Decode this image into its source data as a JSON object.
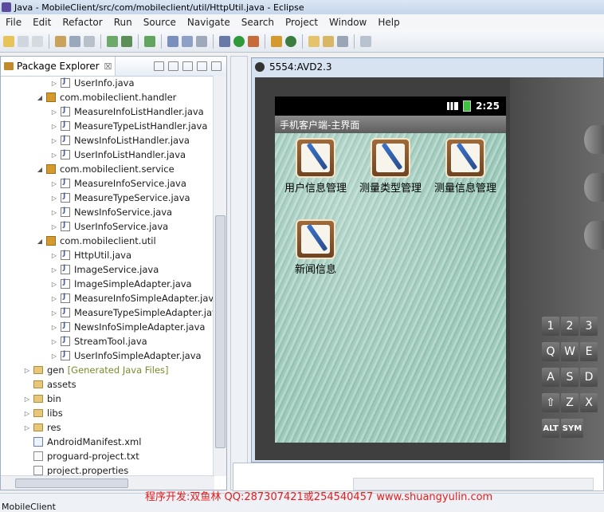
{
  "window": {
    "title": "Java - MobileClient/src/com/mobileclient/util/HttpUtil.java - Eclipse"
  },
  "menu": [
    "File",
    "Edit",
    "Refactor",
    "Run",
    "Source",
    "Navigate",
    "Search",
    "Project",
    "Window",
    "Help"
  ],
  "package_explorer": {
    "tab_label": "Package Explorer",
    "close_glyph": "☒",
    "rows": [
      {
        "label": "UserInfo.java",
        "extra": ""
      },
      {
        "label": "com.mobileclient.handler",
        "extra": ""
      },
      {
        "label": "MeasureInfoListHandler.java",
        "extra": ""
      },
      {
        "label": "MeasureTypeListHandler.java",
        "extra": ""
      },
      {
        "label": "NewsInfoListHandler.java",
        "extra": ""
      },
      {
        "label": "UserInfoListHandler.java",
        "extra": ""
      },
      {
        "label": "com.mobileclient.service",
        "extra": ""
      },
      {
        "label": "MeasureInfoService.java",
        "extra": ""
      },
      {
        "label": "MeasureTypeService.java",
        "extra": ""
      },
      {
        "label": "NewsInfoService.java",
        "extra": ""
      },
      {
        "label": "UserInfoService.java",
        "extra": ""
      },
      {
        "label": "com.mobileclient.util",
        "extra": ""
      },
      {
        "label": "HttpUtil.java",
        "extra": ""
      },
      {
        "label": "ImageService.java",
        "extra": ""
      },
      {
        "label": "ImageSimpleAdapter.java",
        "extra": ""
      },
      {
        "label": "MeasureInfoSimpleAdapter.java",
        "extra": ""
      },
      {
        "label": "MeasureTypeSimpleAdapter.java",
        "extra": ""
      },
      {
        "label": "NewsInfoSimpleAdapter.java",
        "extra": ""
      },
      {
        "label": "StreamTool.java",
        "extra": ""
      },
      {
        "label": "UserInfoSimpleAdapter.java",
        "extra": ""
      },
      {
        "label": "gen",
        "extra": "[Generated Java Files]"
      },
      {
        "label": "assets",
        "extra": ""
      },
      {
        "label": "bin",
        "extra": ""
      },
      {
        "label": "libs",
        "extra": ""
      },
      {
        "label": "res",
        "extra": ""
      },
      {
        "label": "AndroidManifest.xml",
        "extra": ""
      },
      {
        "label": "proguard-project.txt",
        "extra": ""
      },
      {
        "label": "project.properties",
        "extra": ""
      }
    ]
  },
  "emulator": {
    "title": "5554:AVD2.3",
    "time": "2:25",
    "app_title": "手机客户端-主界面",
    "apps": [
      {
        "label": "用户信息管理"
      },
      {
        "label": "测量类型管理"
      },
      {
        "label": "测量信息管理"
      },
      {
        "label": "新闻信息"
      }
    ],
    "keys": [
      "1",
      "2",
      "3",
      "Q",
      "W",
      "E",
      "A",
      "S",
      "D",
      "Z",
      "X",
      "ALT",
      "SYM"
    ]
  },
  "statusbar": {
    "text": "MobileClient"
  },
  "banner": {
    "text": "程序开发:双鱼林 QQ:287307421或254540457 www.shuangyulin.com"
  }
}
